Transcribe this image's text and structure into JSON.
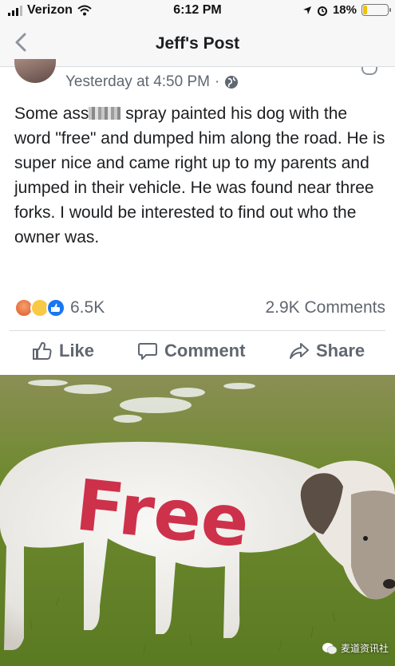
{
  "status_bar": {
    "carrier": "Verizon",
    "time": "6:12 PM",
    "battery": "18%",
    "battery_level": 0.18
  },
  "nav": {
    "title": "Jeff's Post"
  },
  "post": {
    "timestamp": "Yesterday at 4:50 PM",
    "separator": "·",
    "text_before_censor": "Some ass",
    "text_after_censor": " spray painted his dog with the word \"free\" and dumped him along the road. He is super nice and came right up to my parents and jumped in their vehicle. He was found near three forks. I would be interested to find out who the owner was."
  },
  "reactions": {
    "count": "6.5K",
    "comments": "2.9K Comments"
  },
  "actions": {
    "like": "Like",
    "comment": "Comment",
    "share": "Share"
  },
  "photo": {
    "painted_word": "Free",
    "watermark": "麦道资讯社"
  },
  "colors": {
    "facebook_blue": "#1877f2",
    "text_secondary": "#606770",
    "paint_red": "#c8102e",
    "grass_green": "#6d8a2c"
  }
}
